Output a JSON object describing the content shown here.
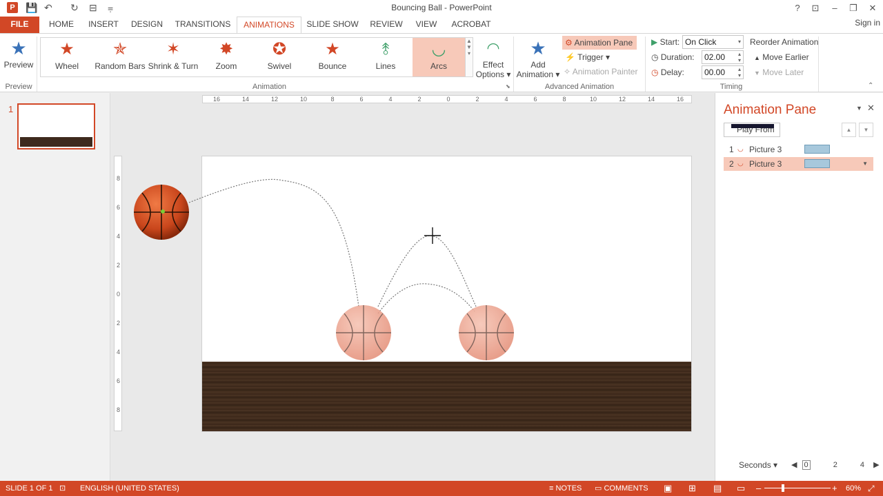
{
  "window": {
    "title": "Bouncing Ball - PowerPoint",
    "app_icon_letter": "P",
    "help": "?",
    "ribbon_display": "⊡",
    "minimize": "–",
    "restore": "❐",
    "close": "✕",
    "sign_in": "Sign in"
  },
  "qat": {
    "save_icon": "💾",
    "undo_icon": "↶",
    "redo_icon": "↻",
    "present_icon": "⊟",
    "customize": "⩦"
  },
  "tabs": {
    "file": "FILE",
    "home": "HOME",
    "insert": "INSERT",
    "design": "DESIGN",
    "transitions": "TRANSITIONS",
    "animations": "ANIMATIONS",
    "slideshow": "SLIDE SHOW",
    "review": "REVIEW",
    "view": "VIEW",
    "acrobat": "ACROBAT"
  },
  "ribbon": {
    "preview": {
      "label": "Preview",
      "group": "Preview"
    },
    "animation_group": "Animation",
    "animations": [
      {
        "label": "Wheel",
        "glyph": "★"
      },
      {
        "label": "Random Bars",
        "glyph": "✯"
      },
      {
        "label": "Shrink & Turn",
        "glyph": "✶"
      },
      {
        "label": "Zoom",
        "glyph": "✸"
      },
      {
        "label": "Swivel",
        "glyph": "✪"
      },
      {
        "label": "Bounce",
        "glyph": "★"
      },
      {
        "label": "Lines",
        "glyph": "⥉"
      },
      {
        "label": "Arcs",
        "glyph": "◡"
      }
    ],
    "effect_options": {
      "line1": "Effect",
      "line2": "Options ▾"
    },
    "add_animation": {
      "line1": "Add",
      "line2": "Animation ▾"
    },
    "animation_pane": "Animation Pane",
    "trigger": "Trigger ▾",
    "animation_painter": "Animation Painter",
    "advanced_group": "Advanced Animation",
    "timing": {
      "start_label": "Start:",
      "start_value": "On Click",
      "duration_label": "Duration:",
      "duration_value": "02.00",
      "delay_label": "Delay:",
      "delay_value": "00.00",
      "reorder_title": "Reorder Animation",
      "move_earlier": "Move Earlier",
      "move_later": "Move Later",
      "group": "Timing"
    }
  },
  "thumbnails": {
    "slide_number": "1"
  },
  "ruler": {
    "h_ticks": [
      "16",
      "14",
      "12",
      "10",
      "8",
      "6",
      "4",
      "2",
      "0",
      "2",
      "4",
      "6",
      "8",
      "10",
      "12",
      "14",
      "16"
    ],
    "v_ticks": [
      "8",
      "6",
      "4",
      "2",
      "0",
      "2",
      "4",
      "6",
      "8"
    ]
  },
  "animation_pane": {
    "title": "Animation Pane",
    "play_from": "Play From",
    "items": [
      {
        "num": "1",
        "name": "Picture 3",
        "selected": false
      },
      {
        "num": "2",
        "name": "Picture 3",
        "selected": true
      }
    ],
    "seconds": "Seconds ▾",
    "timeline": [
      "0",
      "2",
      "4"
    ]
  },
  "status": {
    "slide": "SLIDE 1 OF 1",
    "language": "ENGLISH (UNITED STATES)",
    "notes": "NOTES",
    "comments": "COMMENTS",
    "zoom": "60%"
  },
  "colors": {
    "accent": "#d24726",
    "selection": "#f7c9b9",
    "wood": "#3e2a1e"
  }
}
